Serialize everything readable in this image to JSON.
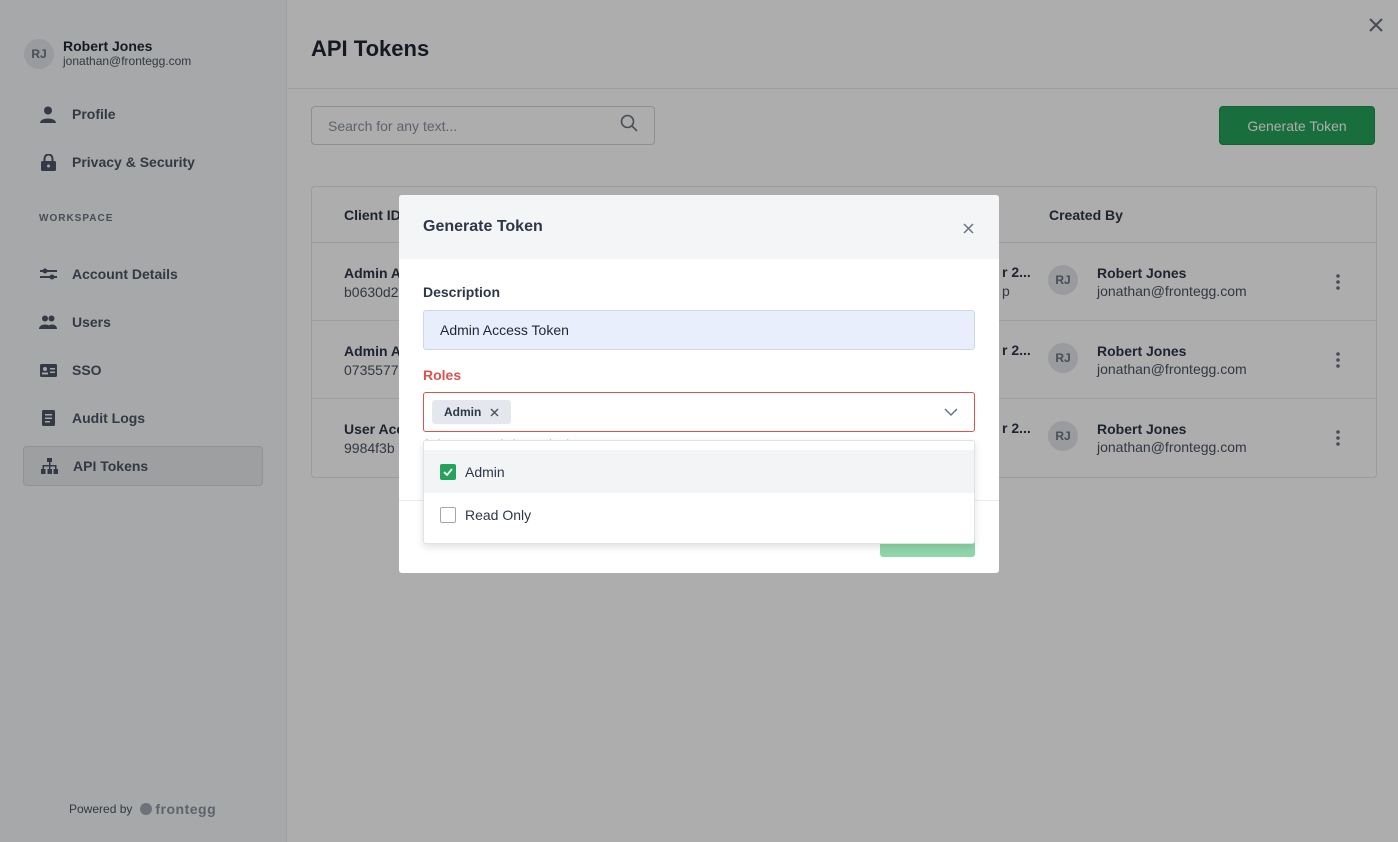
{
  "user": {
    "initials": "RJ",
    "name": "Robert Jones",
    "email": "jonathan@frontegg.com"
  },
  "sidebar": {
    "items_top": [
      {
        "label": "Profile",
        "icon": "person-icon"
      },
      {
        "label": "Privacy & Security",
        "icon": "lock-icon"
      }
    ],
    "section_label": "WORKSPACE",
    "items_workspace": [
      {
        "label": "Account Details",
        "icon": "sliders-icon"
      },
      {
        "label": "Users",
        "icon": "users-icon"
      },
      {
        "label": "SSO",
        "icon": "id-card-icon"
      },
      {
        "label": "Audit Logs",
        "icon": "document-icon"
      },
      {
        "label": "API Tokens",
        "icon": "hierarchy-icon",
        "active": true
      }
    ],
    "powered_by": "Powered by",
    "brand": "frontegg"
  },
  "main": {
    "title": "API Tokens",
    "search_placeholder": "Search for any text...",
    "generate_button": "Generate Token",
    "table": {
      "headers": {
        "client_id": "Client ID",
        "created_by": "Created By"
      },
      "rows": [
        {
          "desc": "Admin A",
          "id": "b0630d2",
          "date": "r 2...",
          "date2": "p",
          "creator_initials": "RJ",
          "creator_name": "Robert Jones",
          "creator_email": "jonathan@frontegg.com"
        },
        {
          "desc": "Admin A",
          "id": "0735577",
          "date": "r 2...",
          "date2": "",
          "creator_initials": "RJ",
          "creator_name": "Robert Jones",
          "creator_email": "jonathan@frontegg.com"
        },
        {
          "desc": "User Acc",
          "id": "9984f3b",
          "date": "r 2...",
          "date2": "",
          "creator_initials": "RJ",
          "creator_name": "Robert Jones",
          "creator_email": "jonathan@frontegg.com"
        }
      ]
    }
  },
  "modal": {
    "title": "Generate Token",
    "description_label": "Description",
    "description_value": "Admin Access Token",
    "roles_label": "Roles",
    "selected_role": "Admin",
    "helper_text": "At least one role is required",
    "options": [
      {
        "label": "Admin",
        "checked": true
      },
      {
        "label": "Read Only",
        "checked": false
      }
    ]
  },
  "colors": {
    "accent_green": "#26a35a",
    "error_red": "#d9534f"
  }
}
